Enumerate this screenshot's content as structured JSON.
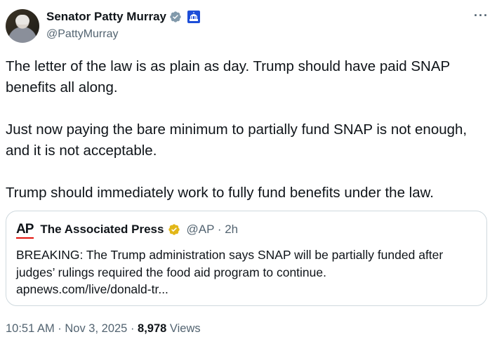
{
  "author": {
    "name": "Senator Patty Murray",
    "handle": "@PattyMurray",
    "verified_badge_color": "#829aab",
    "affiliation_badge_color": "#1d4ed8",
    "avatar_icon": "avatar-photo"
  },
  "more_icon": "more-icon",
  "more_label": "···",
  "tweet": {
    "text": "The letter of the law is as plain as day. Trump should have paid SNAP benefits all along.\n\nJust now paying the bare minimum to partially fund SNAP is not enough, and it is not acceptable.\n\nTrump should immediately work to fully fund benefits under the law."
  },
  "quoted": {
    "logo_text": "AP",
    "name": "The Associated Press",
    "verified_badge_color": "#e2b719",
    "meta": "@AP · 2h",
    "text": "BREAKING: The Trump administration says SNAP will be partially funded after judges’ rulings required the food aid program to continue.\napnews.com/live/donald-tr..."
  },
  "footer": {
    "time": "10:51 AM · Nov 3, 2025 · ",
    "views_count": "8,978",
    "views_label": " Views"
  }
}
